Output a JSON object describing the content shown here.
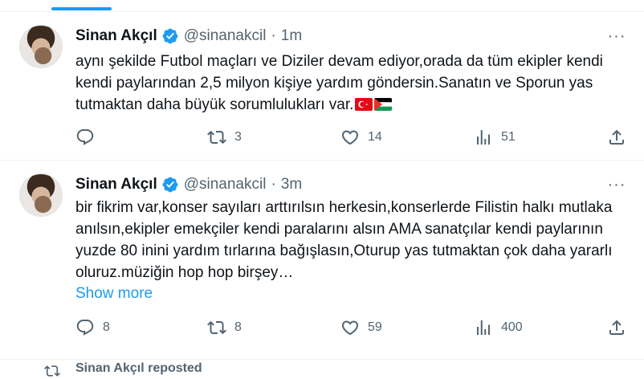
{
  "colors": {
    "accent": "#1d9bf0",
    "muted": "#536471",
    "text": "#0f1419",
    "border": "#eff3f4"
  },
  "tweets": [
    {
      "name": "Sinan Akçıl",
      "handle": "@sinanakcil",
      "dot": "·",
      "time": "1m",
      "text": "aynı şekilde Futbol maçları ve Diziler devam ediyor,orada da tüm ekipler kendi kendi paylarından 2,5 milyon kişiye yardım göndersin.Sanatın ve Sporun yas tutmaktan daha büyük sorumlulukları var.",
      "flags": [
        "turkey-flag",
        "palestine-flag"
      ],
      "replies": "",
      "reposts": "3",
      "likes": "14",
      "views": "51"
    },
    {
      "name": "Sinan Akçıl",
      "handle": "@sinanakcil",
      "dot": "·",
      "time": "3m",
      "text": "bir fikrim var,konser sayıları arttırılsın herkesin,konserlerde Filistin halkı mutlaka anılsın,ekipler emekçiler kendi paralarını alsın AMA sanatçılar kendi paylarının yuzde 80 inini yardım tırlarına bağışlasın,Oturup yas tutmaktan çok daha yararlı oluruz.müziğin hop hop birşey…",
      "show_more": "Show more",
      "replies": "8",
      "reposts": "8",
      "likes": "59",
      "views": "400"
    }
  ],
  "repost_notice": {
    "text": "Sinan Akçıl reposted"
  }
}
